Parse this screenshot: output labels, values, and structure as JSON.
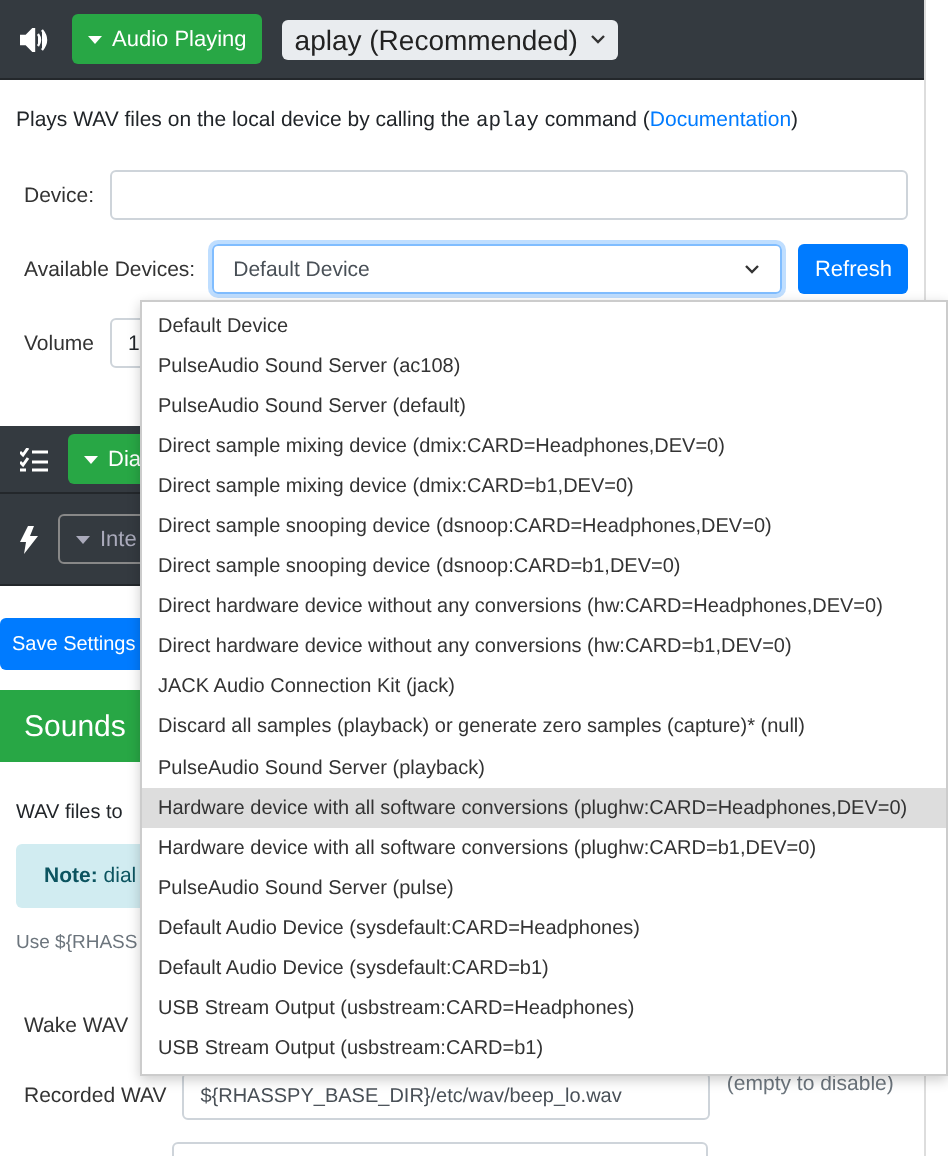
{
  "toolbar": {
    "status_button": {
      "label": "Audio Playing"
    },
    "system_select": {
      "value": "aplay (Recommended)"
    }
  },
  "description": {
    "before": "Plays WAV files on the local device by calling the ",
    "code": "aplay",
    "after": " command (",
    "link": "Documentation",
    "end": ")"
  },
  "device": {
    "label": "Device:"
  },
  "available_devices": {
    "label": "Available Devices:",
    "value": "Default Device",
    "refresh": "Refresh",
    "expanded": true
  },
  "volume": {
    "label": "Volume",
    "value": "1"
  },
  "sections": [
    {
      "kind": "dialogue",
      "button": "Dia"
    },
    {
      "kind": "intent",
      "button": "Inte"
    }
  ],
  "save_button": "Save Settings",
  "sounds": {
    "title": "Sounds",
    "intro": "WAV files to",
    "note": {
      "label": "Note:",
      "text": "dial"
    },
    "hint": "Use ${RHASS",
    "rows": [
      {
        "kind": "label",
        "label": "Wake WAV"
      },
      {
        "kind": "file",
        "label": "Recorded WAV",
        "value": "${RHASSPY_BASE_DIR}/etc/wav/beep_lo.wav",
        "hint": "(empty to disable)"
      },
      {
        "kind": "file"
      }
    ]
  },
  "menu": {
    "items": [
      {
        "label": "Default Device",
        "highlighted": false
      },
      {
        "label": "PulseAudio Sound Server (ac108)",
        "highlighted": false
      },
      {
        "label": "PulseAudio Sound Server (default)",
        "highlighted": false
      },
      {
        "label": "Direct sample mixing device (dmix:CARD=Headphones,DEV=0)",
        "highlighted": false
      },
      {
        "label": "Direct sample mixing device (dmix:CARD=b1,DEV=0)",
        "highlighted": false
      },
      {
        "label": "Direct sample snooping device (dsnoop:CARD=Headphones,DEV=0)",
        "highlighted": false
      },
      {
        "label": "Direct sample snooping device (dsnoop:CARD=b1,DEV=0)",
        "highlighted": false
      },
      {
        "label": "Direct hardware device without any conversions (hw:CARD=Headphones,DEV=0)",
        "highlighted": false
      },
      {
        "label": "Direct hardware device without any conversions (hw:CARD=b1,DEV=0)",
        "highlighted": false
      },
      {
        "label": "JACK Audio Connection Kit (jack)",
        "highlighted": false
      },
      {
        "label": "Discard all samples (playback) or generate zero samples (capture)* (null)",
        "highlighted": false
      },
      {
        "label": "PulseAudio Sound Server (playback)",
        "highlighted": false
      },
      {
        "label": "Hardware device with all software conversions (plughw:CARD=Headphones,DEV=0)",
        "highlighted": true
      },
      {
        "label": "Hardware device with all software conversions (plughw:CARD=b1,DEV=0)",
        "highlighted": false
      },
      {
        "label": "PulseAudio Sound Server (pulse)",
        "highlighted": false
      },
      {
        "label": "Default Audio Device (sysdefault:CARD=Headphones)",
        "highlighted": false
      },
      {
        "label": "Default Audio Device (sysdefault:CARD=b1)",
        "highlighted": false
      },
      {
        "label": "USB Stream Output (usbstream:CARD=Headphones)",
        "highlighted": false
      },
      {
        "label": "USB Stream Output (usbstream:CARD=b1)",
        "highlighted": false
      }
    ]
  }
}
